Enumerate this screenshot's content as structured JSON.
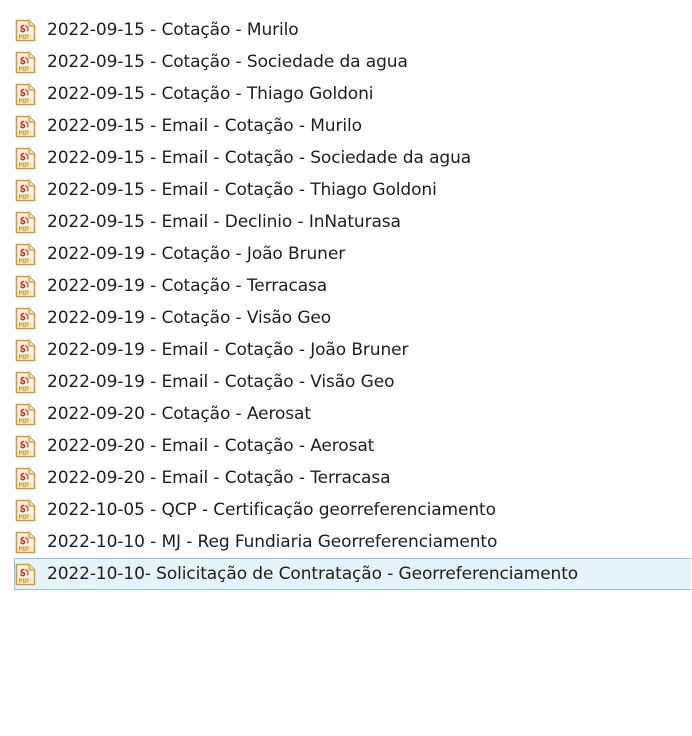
{
  "files": [
    {
      "name": "2022-09-15 - Cotação - Murilo",
      "icon": "pdf-file-icon",
      "selected": false
    },
    {
      "name": "2022-09-15 - Cotação - Sociedade da agua",
      "icon": "pdf-file-icon",
      "selected": false
    },
    {
      "name": "2022-09-15 - Cotação - Thiago Goldoni",
      "icon": "pdf-file-icon",
      "selected": false
    },
    {
      "name": "2022-09-15 - Email - Cotação - Murilo",
      "icon": "pdf-file-icon",
      "selected": false
    },
    {
      "name": "2022-09-15 - Email - Cotação - Sociedade da agua",
      "icon": "pdf-file-icon",
      "selected": false
    },
    {
      "name": "2022-09-15 - Email - Cotação - Thiago Goldoni",
      "icon": "pdf-file-icon",
      "selected": false
    },
    {
      "name": "2022-09-15 - Email - Declinio - InNaturasa",
      "icon": "pdf-file-icon",
      "selected": false
    },
    {
      "name": "2022-09-19 - Cotação - João Bruner",
      "icon": "pdf-file-icon",
      "selected": false
    },
    {
      "name": "2022-09-19 - Cotação - Terracasa",
      "icon": "pdf-file-icon",
      "selected": false
    },
    {
      "name": "2022-09-19 - Cotação - Visão Geo",
      "icon": "pdf-file-icon",
      "selected": false
    },
    {
      "name": "2022-09-19 - Email - Cotação - João Bruner",
      "icon": "pdf-file-icon",
      "selected": false
    },
    {
      "name": "2022-09-19 - Email - Cotação - Visão Geo",
      "icon": "pdf-file-icon",
      "selected": false
    },
    {
      "name": "2022-09-20 - Cotação - Aerosat",
      "icon": "pdf-file-icon",
      "selected": false
    },
    {
      "name": "2022-09-20 - Email - Cotação - Aerosat",
      "icon": "pdf-file-icon",
      "selected": false
    },
    {
      "name": "2022-09-20 - Email - Cotação - Terracasa",
      "icon": "pdf-file-icon",
      "selected": false
    },
    {
      "name": "2022-10-05 - QCP - Certificação georreferenciamento",
      "icon": "pdf-file-icon",
      "selected": false
    },
    {
      "name": "2022-10-10 - MJ - Reg Fundiaria Georreferenciamento",
      "icon": "pdf-file-icon",
      "selected": false
    },
    {
      "name": "2022-10-10- Solicitação de Contratação - Georreferenciamento",
      "icon": "pdf-file-icon",
      "selected": true
    }
  ],
  "colors": {
    "icon_border": "#d79a2e",
    "icon_fill": "#fff7e3",
    "icon_glyph": "#d9262f",
    "selection_bg": "#e5f3fb",
    "selection_border": "#8ec7ec",
    "text": "#1e1e1e"
  }
}
